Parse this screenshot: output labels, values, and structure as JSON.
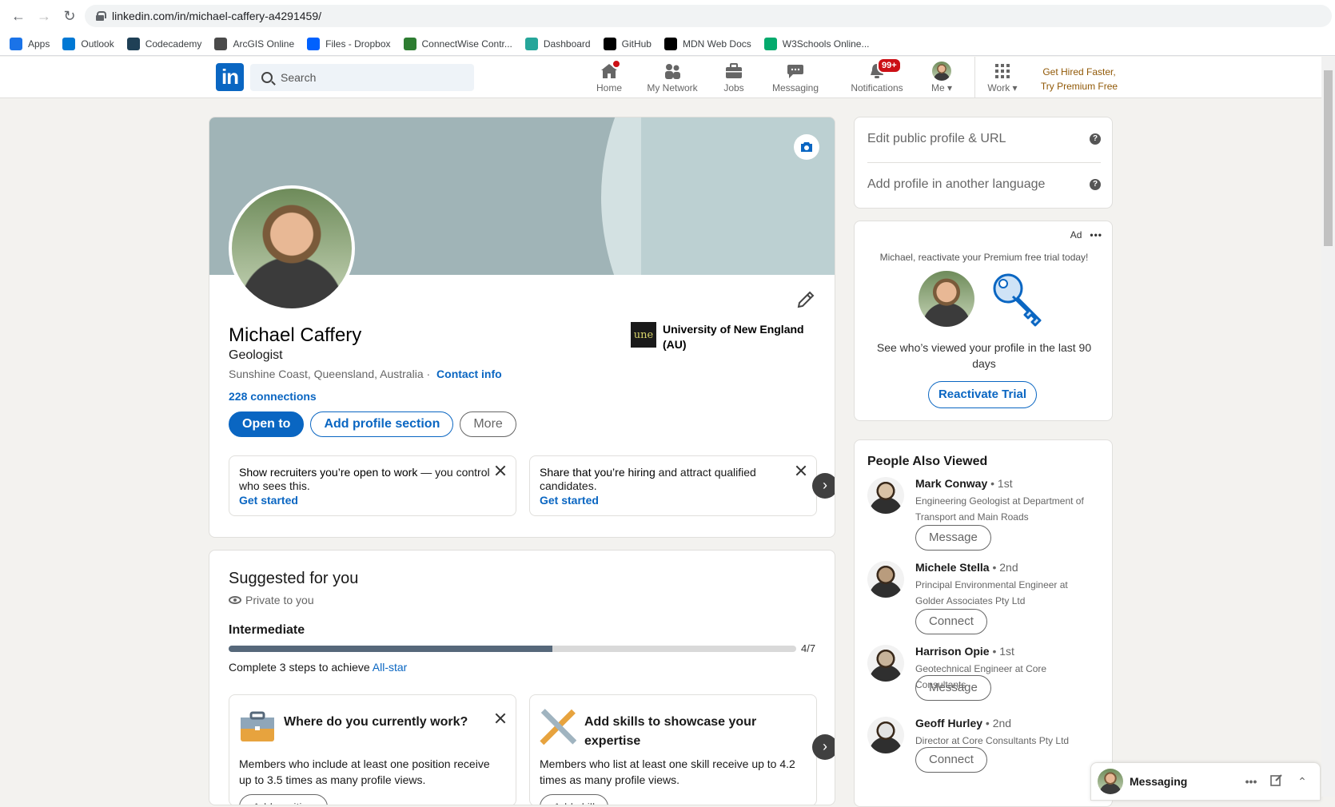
{
  "browser": {
    "url": "linkedin.com/in/michael-caffery-a4291459/",
    "bookmarks": [
      {
        "label": "Apps",
        "icon": "apps-grid-icon",
        "color": "#1a73e8"
      },
      {
        "label": "Outlook",
        "icon": "outlook-icon",
        "color": "#0078d4"
      },
      {
        "label": "Codecademy",
        "icon": "codecademy-icon",
        "color": "#1f4056"
      },
      {
        "label": "ArcGIS Online",
        "icon": "arcgis-icon",
        "color": "#4a4a4a"
      },
      {
        "label": "Files - Dropbox",
        "icon": "dropbox-icon",
        "color": "#0061fe"
      },
      {
        "label": "ConnectWise Contr...",
        "icon": "connectwise-icon",
        "color": "#2e7d32"
      },
      {
        "label": "Dashboard",
        "icon": "dashboard-icon",
        "color": "#26a69a"
      },
      {
        "label": "GitHub",
        "icon": "github-icon",
        "color": "#000000"
      },
      {
        "label": "MDN Web Docs",
        "icon": "mdn-icon",
        "color": "#000000"
      },
      {
        "label": "W3Schools Online...",
        "icon": "w3schools-icon",
        "color": "#04aa6d"
      }
    ]
  },
  "nav": {
    "search_placeholder": "Search",
    "items": [
      {
        "label": "Home",
        "badge": ""
      },
      {
        "label": "My Network",
        "badge": ""
      },
      {
        "label": "Jobs",
        "badge": ""
      },
      {
        "label": "Messaging",
        "badge": ""
      },
      {
        "label": "Notifications",
        "badge": "99+"
      },
      {
        "label": "Me",
        "badge": ""
      },
      {
        "label": "Work",
        "badge": ""
      }
    ],
    "premium_line1": "Get Hired Faster,",
    "premium_line2": "Try Premium Free"
  },
  "profile": {
    "name": "Michael Caffery",
    "headline": "Geologist",
    "location": "Sunshine Coast, Queensland, Australia ·",
    "contact_info": "Contact info",
    "connections": "228 connections",
    "education_logo": "une",
    "education": "University of New England (AU)",
    "buttons": {
      "open_to": "Open to",
      "add_section": "Add profile section",
      "more": "More"
    },
    "cards": [
      {
        "strong": "Show recruiters you’re open to work",
        "rest": " — you control who sees this.",
        "cta": "Get started"
      },
      {
        "strong": "Share that you’re hiring",
        "rest": " and attract qualified candidates.",
        "cta": "Get started"
      }
    ]
  },
  "suggested": {
    "title": "Suggested for you",
    "private": "Private to you",
    "level": "Intermediate",
    "progress": 0.571,
    "progress_label": "4/7",
    "complete_text": "Complete 3 steps to achieve ",
    "complete_link": "All-star",
    "cards": [
      {
        "title": "Where do you currently work?",
        "body": "Members who include at least one position receive up to 3.5 times as many profile views.",
        "button": "Add position"
      },
      {
        "title": "Add skills to showcase your expertise",
        "body": "Members who list at least one skill receive up to 4.2 times as many profile views.",
        "button": "Add skill"
      }
    ]
  },
  "sidebar": {
    "edit_public": "Edit public profile & URL",
    "add_language": "Add profile in another language",
    "ad": {
      "label": "Ad",
      "subtitle": "Michael, reactivate your Premium free trial today!",
      "text": "See who’s viewed your profile in the last 90 days",
      "button": "Reactivate Trial"
    },
    "people_title": "People Also Viewed",
    "people": [
      {
        "name": "Mark Conway",
        "degree": "• 1st",
        "role": "Engineering Geologist at Department of Transport and Main Roads",
        "button": "Message"
      },
      {
        "name": "Michele Stella",
        "degree": "• 2nd",
        "role": "Principal Environmental Engineer at Golder Associates Pty Ltd",
        "button": "Connect"
      },
      {
        "name": "Harrison Opie",
        "degree": "• 1st",
        "role": "Geotechnical Engineer at Core Consultants",
        "button": "Message"
      },
      {
        "name": "Geoff Hurley",
        "degree": "• 2nd",
        "role": "Director at Core Consultants Pty Ltd",
        "button": "Connect"
      }
    ]
  },
  "messaging": {
    "label": "Messaging"
  },
  "colors": {
    "brand": "#0a66c2",
    "badge": "#cc1016",
    "premium": "#915907"
  }
}
